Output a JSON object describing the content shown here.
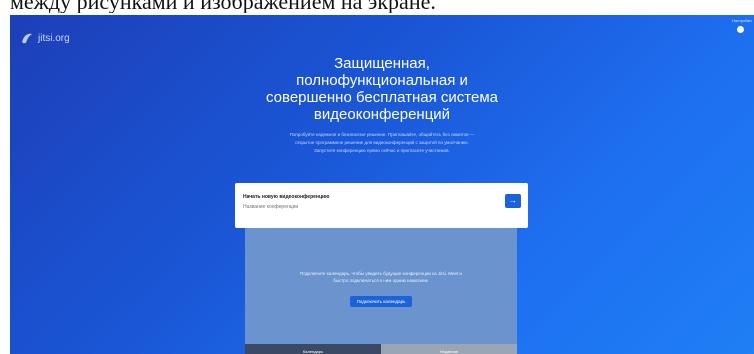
{
  "caption": "между рисунками и изображением на экране.",
  "app": {
    "logo_text": "jitsi.org",
    "menu_hint": "Настройки"
  },
  "hero": {
    "headline": "Защищенная,\nполнофункциональная и\nсовершенно бесплатная система\nвидеоконференций",
    "subtext": "Попробуйте надежное и безопасное решение. Приглашайте, общайтесь без лимитов —\nоткрытое программное решение для видеоконференций с защитой по умолчанию.\nЗапустите конференцию прямо сейчас и пригласите участников."
  },
  "start_card": {
    "title": "Начать новую видеоконференцию",
    "input_placeholder": "Название конференции",
    "go_label": "→"
  },
  "calendar_panel": {
    "text": "Подключите календарь, чтобы увидеть будущие конференции из Jitsi. Meet и\nбыстро подключаться к ним одним нажатием.",
    "button_label": "Подключить календарь"
  },
  "tabs": [
    "Календарь",
    "Недавние"
  ]
}
